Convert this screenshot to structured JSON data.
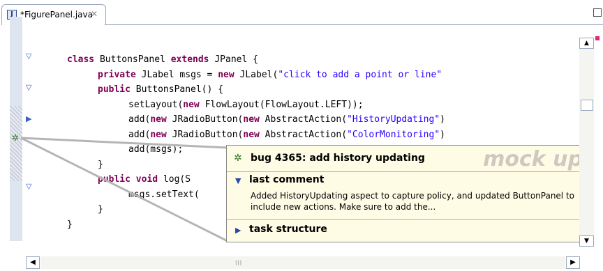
{
  "tab": {
    "title": "*FigurePanel.java",
    "icon": "J",
    "close_glyph": "✕"
  },
  "code_lines": [
    {
      "indent": 0,
      "parts": [
        {
          "t": "class",
          "c": "kw"
        },
        {
          "t": " ButtonsPanel "
        },
        {
          "t": "extends",
          "c": "kw"
        },
        {
          "t": " JPanel {"
        }
      ]
    },
    {
      "indent": 1,
      "parts": [
        {
          "t": "private",
          "c": "kw"
        },
        {
          "t": " JLabel msgs = "
        },
        {
          "t": "new",
          "c": "kw"
        },
        {
          "t": " JLabel("
        },
        {
          "t": "\"click to add a point or line\"",
          "c": "str"
        }
      ]
    },
    {
      "indent": 1,
      "parts": [
        {
          "t": "public",
          "c": "kw"
        },
        {
          "t": " ButtonsPanel() {"
        }
      ]
    },
    {
      "indent": 2,
      "parts": [
        {
          "t": "setLayout("
        },
        {
          "t": "new",
          "c": "kw"
        },
        {
          "t": " FlowLayout(FlowLayout.LEFT));"
        }
      ]
    },
    {
      "indent": 2,
      "parts": [
        {
          "t": "add("
        },
        {
          "t": "new",
          "c": "kw"
        },
        {
          "t": " JRadioButton("
        },
        {
          "t": "new",
          "c": "kw"
        },
        {
          "t": " AbstractAction("
        },
        {
          "t": "\"HistoryUpdating\"",
          "c": "str"
        },
        {
          "t": ")"
        }
      ]
    },
    {
      "indent": 2,
      "parts": [
        {
          "t": "add("
        },
        {
          "t": "new",
          "c": "kw"
        },
        {
          "t": " JRadioButton("
        },
        {
          "t": "new",
          "c": "kw"
        },
        {
          "t": " AbstractAction("
        },
        {
          "t": "\"ColorMonitoring\"",
          "c": "str"
        },
        {
          "t": ")"
        }
      ]
    },
    {
      "indent": 2,
      "parts": [
        {
          "t": "add(msgs);"
        }
      ]
    },
    {
      "indent": 1,
      "parts": [
        {
          "t": "}"
        }
      ]
    },
    {
      "indent": 1,
      "parts": [
        {
          "t": "public",
          "c": "kw"
        },
        {
          "t": " "
        },
        {
          "t": "void",
          "c": "kw"
        },
        {
          "t": " log(S"
        }
      ]
    },
    {
      "indent": 2,
      "parts": [
        {
          "t": "msgs.setText("
        }
      ]
    },
    {
      "indent": 1,
      "parts": [
        {
          "t": "}"
        }
      ]
    },
    {
      "indent": 0,
      "parts": [
        {
          "t": "}"
        }
      ]
    }
  ],
  "popup": {
    "title": "bug 4365: add history updating",
    "watermark": "mock up",
    "last_comment_label": "last comment",
    "comment_text": "Added HistoryUpdating aspect to capture policy, and updated ButtonPanel to include new actions.  Make sure to add the...",
    "task_structure_label": "task structure"
  },
  "colors": {
    "keyword": "#7f0055",
    "string": "#2a00ff",
    "popup_bg": "#fffce6",
    "ruler": "#dfe4f1"
  },
  "icons": {
    "fold": "fold-triangle-icon",
    "bug": "bug-icon",
    "close": "close-icon"
  }
}
